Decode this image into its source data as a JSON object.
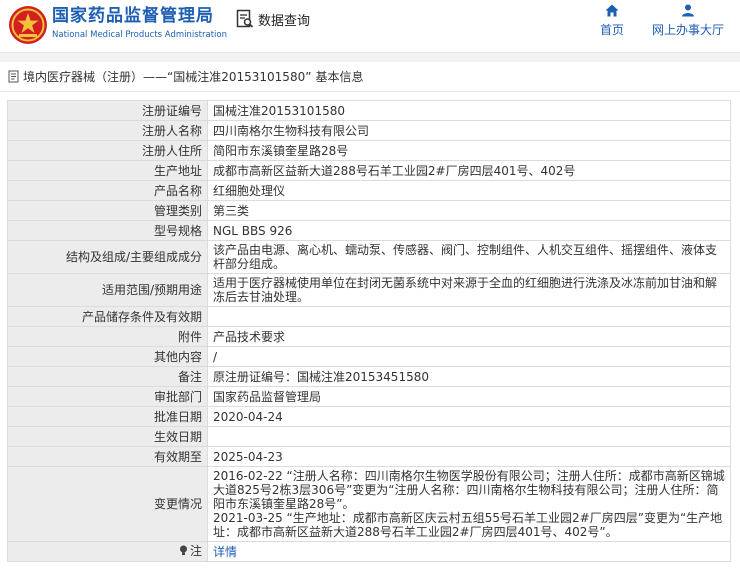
{
  "header": {
    "brand_cn": "国家药品监督管理局",
    "brand_en": "National Medical Products Administration",
    "data_query": "数据查询",
    "nav": {
      "home": "首页",
      "hall": "网上办事大厅"
    },
    "accent_color": "#1f5fb3"
  },
  "breadcrumb": {
    "section": "境内医疗器械（注册）",
    "separator": "——",
    "record": "“国械注准20153101580”",
    "suffix": "基本信息"
  },
  "rows": [
    {
      "label": "注册证编号",
      "value": "国械注准20153101580"
    },
    {
      "label": "注册人名称",
      "value": "四川南格尔生物科技有限公司"
    },
    {
      "label": "注册人住所",
      "value": "简阳市东溪镇奎星路28号"
    },
    {
      "label": "生产地址",
      "value": "成都市高新区益新大道288号石羊工业园2#厂房四层401号、402号"
    },
    {
      "label": "产品名称",
      "value": "红细胞处理仪"
    },
    {
      "label": "管理类别",
      "value": "第三类"
    },
    {
      "label": "型号规格",
      "value": "NGL BBS 926"
    },
    {
      "label": "结构及组成/主要组成成分",
      "value": "该产品由电源、离心机、蠕动泵、传感器、阀门、控制组件、人机交互组件、摇摆组件、液体支杆部分组成。"
    },
    {
      "label": "适用范围/预期用途",
      "value": "适用于医疗器械使用单位在封闭无菌系统中对来源于全血的红细胞进行洗涤及冰冻前加甘油和解冻后去甘油处理。"
    },
    {
      "label": "产品储存条件及有效期",
      "value": ""
    },
    {
      "label": "附件",
      "value": "产品技术要求"
    },
    {
      "label": "其他内容",
      "value": "/"
    },
    {
      "label": "备注",
      "value": "原注册证编号：国械注准20153451580"
    },
    {
      "label": "审批部门",
      "value": "国家药品监督管理局"
    },
    {
      "label": "批准日期",
      "value": "2020-04-24"
    },
    {
      "label": "生效日期",
      "value": ""
    },
    {
      "label": "有效期至",
      "value": "2025-04-23"
    }
  ],
  "changes": {
    "label": "变更情况",
    "lines": [
      "2016-02-22 “注册人名称：四川南格尔生物医学股份有限公司；注册人住所：成都市高新区锦城大道825号2栋3层306号”变更为“注册人名称：四川南格尔生物科技有限公司；注册人住所：简阳市东溪镇奎星路28号”。",
      "2021-03-25 “生产地址：成都市高新区庆云村五组55号石羊工业园2#厂房四层”变更为“生产地址：成都市高新区益新大道288号石羊工业园2#厂房四层401号、402号”。"
    ]
  },
  "note": {
    "label": "注",
    "link": "详情"
  }
}
